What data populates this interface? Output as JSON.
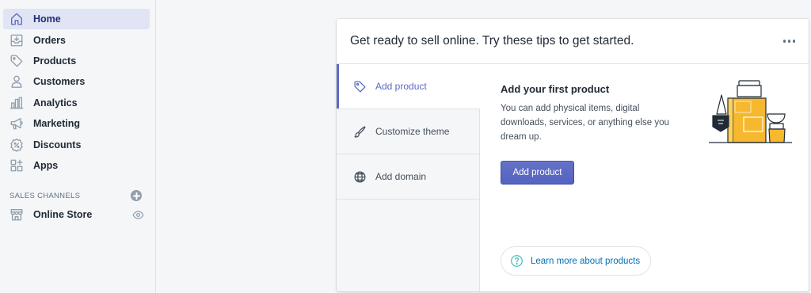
{
  "sidebar": {
    "items": [
      {
        "label": "Home",
        "icon": "home-icon",
        "active": true
      },
      {
        "label": "Orders",
        "icon": "orders-icon"
      },
      {
        "label": "Products",
        "icon": "tag-icon"
      },
      {
        "label": "Customers",
        "icon": "person-icon"
      },
      {
        "label": "Analytics",
        "icon": "bar-chart-icon"
      },
      {
        "label": "Marketing",
        "icon": "megaphone-icon"
      },
      {
        "label": "Discounts",
        "icon": "discount-icon"
      },
      {
        "label": "Apps",
        "icon": "apps-icon"
      }
    ],
    "sales_channels_title": "SALES CHANNELS",
    "channels": [
      {
        "label": "Online Store",
        "icon": "store-icon"
      }
    ]
  },
  "card": {
    "title": "Get ready to sell online. Try these tips to get started.",
    "tabs": [
      {
        "label": "Add product",
        "icon": "tag-icon",
        "active": true
      },
      {
        "label": "Customize theme",
        "icon": "brush-icon"
      },
      {
        "label": "Add domain",
        "icon": "globe-icon"
      }
    ],
    "content": {
      "heading": "Add your first product",
      "body": "You can add physical items, digital downloads, services, or anything else you dream up.",
      "button_label": "Add product",
      "learn_more_label": "Learn more about products"
    }
  },
  "colors": {
    "accent": "#5c6ac4",
    "active_nav_bg": "#e1e4f4",
    "link": "#006fbb",
    "help_icon": "#47c1bf",
    "illustration_yellow": "#f5b82e"
  }
}
